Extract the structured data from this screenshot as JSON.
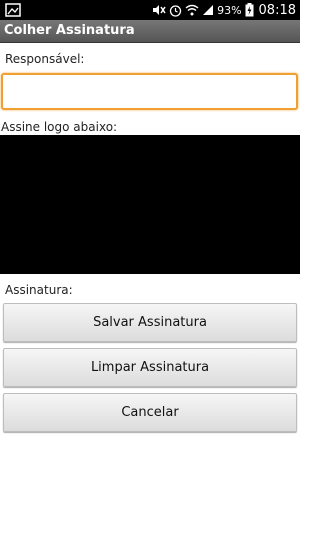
{
  "status_bar": {
    "battery": "93%",
    "time": "08:18",
    "icons": [
      "gallery-icon",
      "mute-icon",
      "alarm-icon",
      "wifi-icon",
      "signal-icon",
      "battery-icon"
    ]
  },
  "app": {
    "title": "Colher Assinatura"
  },
  "form": {
    "responsavel_label": "Responsável:",
    "responsavel_value": "",
    "signature_prompt": "Assine logo abaixo:",
    "assinatura_label": "Assinatura:"
  },
  "buttons": {
    "save": "Salvar Assinatura",
    "clear": "Limpar Assinatura",
    "cancel": "Cancelar"
  },
  "colors": {
    "focus_border": "#f0a030",
    "signature_pad": "#000000"
  }
}
